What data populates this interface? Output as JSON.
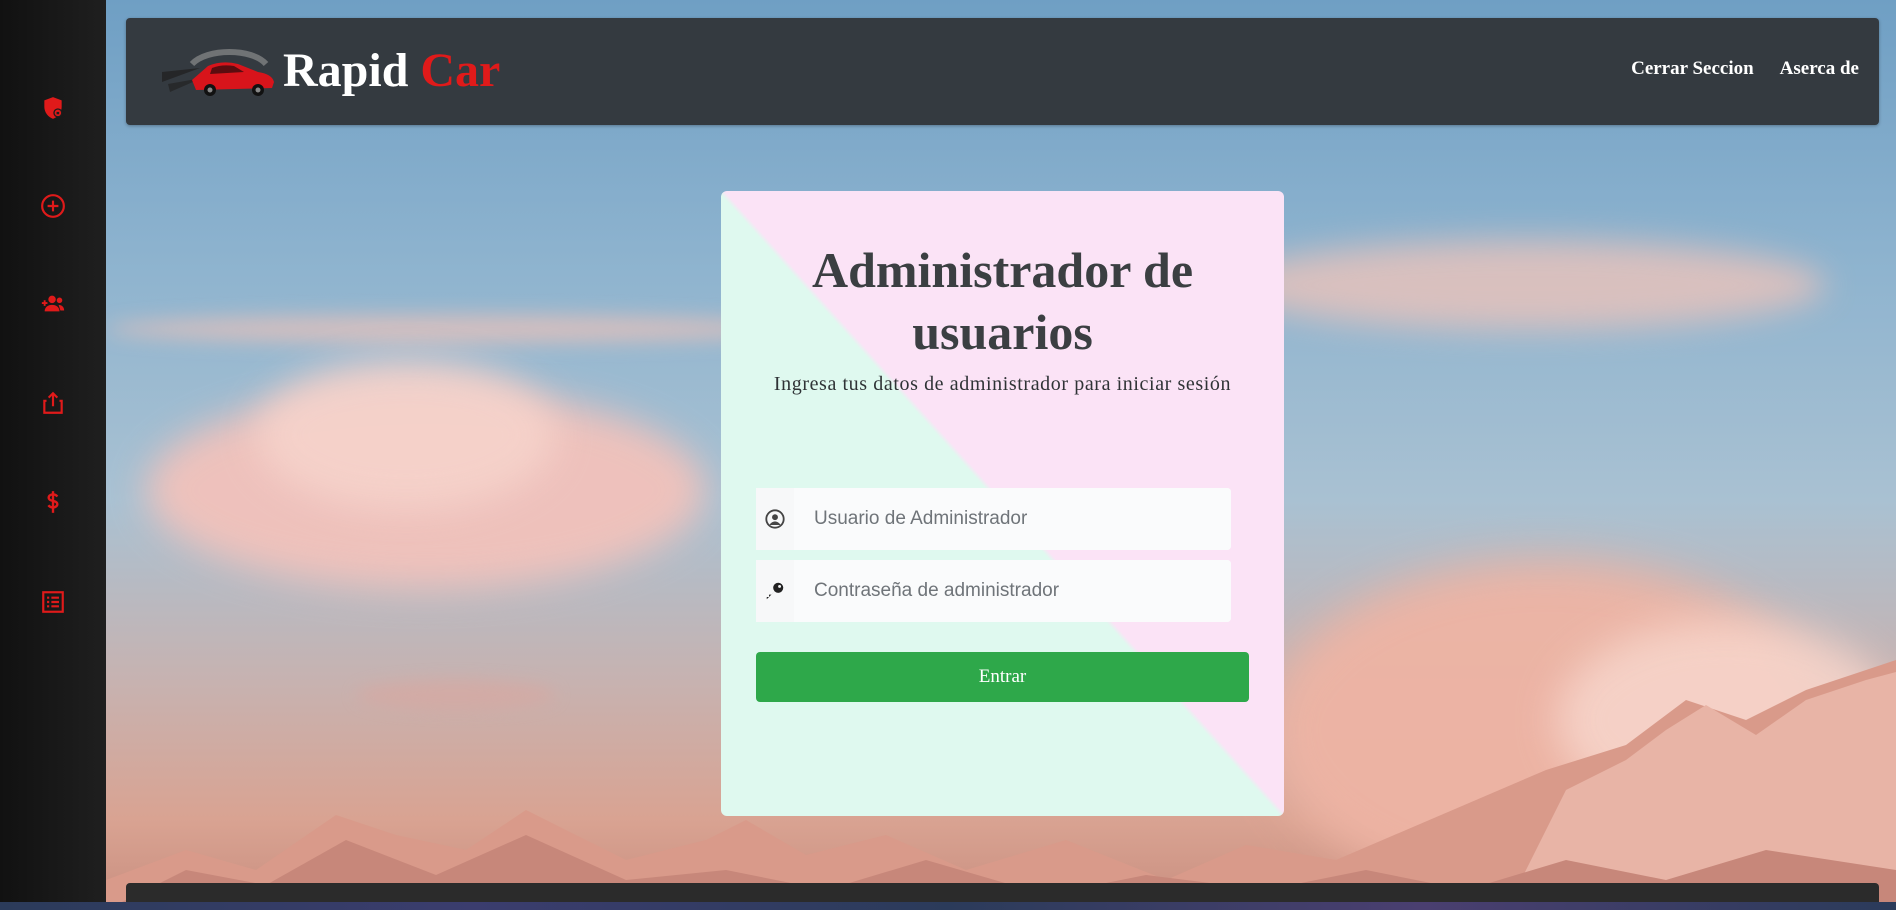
{
  "brand": {
    "name": "Rapid",
    "accent": "Car",
    "accent_color": "#e01a1a"
  },
  "nav": [
    {
      "label": "Cerrar Seccion"
    },
    {
      "label": "Aserca de"
    }
  ],
  "sidebar": {
    "icon_color": "#e01a1a",
    "items": [
      {
        "icon": "shield-lock-icon"
      },
      {
        "icon": "plus-circle-icon"
      },
      {
        "icon": "user-plus-icon"
      },
      {
        "icon": "share-upload-icon"
      },
      {
        "icon": "dollar-icon"
      },
      {
        "icon": "list-icon"
      }
    ]
  },
  "login": {
    "title": "Administrador de usuarios",
    "subtitle": "Ingresa tus datos de administrador para iniciar sesión",
    "username": {
      "value": "",
      "placeholder": "Usuario de Administrador",
      "icon": "user-circle-icon"
    },
    "password": {
      "value": "",
      "placeholder": "Contraseña de administrador",
      "icon": "key-icon"
    },
    "submit_label": "Entrar",
    "submit_color": "#2ea84a"
  }
}
